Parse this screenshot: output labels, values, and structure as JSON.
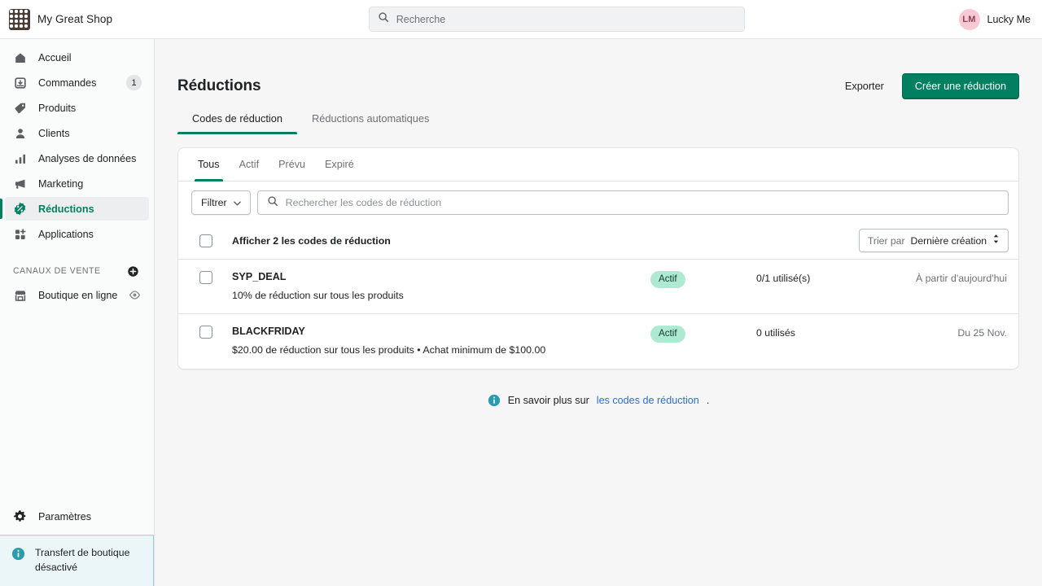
{
  "topbar": {
    "brand_name": "My Great Shop",
    "brand_logo_icon": "checkered-pattern-logo",
    "search": {
      "placeholder": "Recherche",
      "icon": "search-icon"
    },
    "user": {
      "initials": "LM",
      "name": "Lucky Me"
    }
  },
  "sidebar": {
    "items": [
      {
        "label": "Accueil",
        "icon": "home-icon",
        "badge": ""
      },
      {
        "label": "Commandes",
        "icon": "orders-inbox-icon",
        "badge": "1"
      },
      {
        "label": "Produits",
        "icon": "tag-icon",
        "badge": ""
      },
      {
        "label": "Clients",
        "icon": "person-icon",
        "badge": ""
      },
      {
        "label": "Analyses de données",
        "icon": "bar-chart-icon",
        "badge": ""
      },
      {
        "label": "Marketing",
        "icon": "megaphone-icon",
        "badge": ""
      },
      {
        "label": "Réductions",
        "icon": "discount-badge-icon",
        "badge": ""
      },
      {
        "label": "Applications",
        "icon": "apps-grid-icon",
        "badge": ""
      }
    ],
    "active_item": "Réductions",
    "sales_channels": {
      "title": "CANAUX DE VENTE",
      "add_icon": "plus-circle-icon",
      "channels": [
        {
          "label": "Boutique en ligne",
          "icon": "storefront-icon",
          "trailing_icon": "eye-icon"
        }
      ]
    },
    "settings": {
      "label": "Paramètres",
      "icon": "gear-icon"
    },
    "notice": {
      "text": "Transfert de boutique désactivé",
      "icon": "info-circle-icon"
    }
  },
  "page": {
    "title": "Réductions",
    "export_label": "Exporter",
    "create_label": "Créer une réduction",
    "top_tabs": [
      {
        "label": "Codes de réduction",
        "active": true
      },
      {
        "label": "Réductions automatiques",
        "active": false
      }
    ]
  },
  "card": {
    "tabs": [
      {
        "label": "Tous",
        "active": true
      },
      {
        "label": "Actif",
        "active": false
      },
      {
        "label": "Prévu",
        "active": false
      },
      {
        "label": "Expiré",
        "active": false
      }
    ],
    "filter_button": {
      "label": "Filtrer",
      "icon": "chevron-down-icon"
    },
    "search": {
      "placeholder": "Rechercher les codes de réduction",
      "value": "",
      "icon": "search-icon"
    },
    "select_all": {
      "label": "Afficher 2 les codes de réduction",
      "checked": false
    },
    "sort": {
      "prefix": "Trier par",
      "value": "Dernière création",
      "icon": "sort-updown-icon"
    },
    "rows": [
      {
        "code": "SYP_DEAL",
        "description": "10% de réduction sur tous les produits",
        "status": "Actif",
        "usage": "0/1 utilisé(s)",
        "date": "À partir d'aujourd'hui",
        "checked": false
      },
      {
        "code": "BLACKFRIDAY",
        "description": "$20.00 de réduction sur tous les produits • Achat minimum de $100.00",
        "status": "Actif",
        "usage": "0 utilisés",
        "date": "Du 25 Nov.",
        "checked": false
      }
    ]
  },
  "footer": {
    "icon": "info-circle-icon",
    "text": "En savoir plus sur ",
    "link_text": "les codes de réduction",
    "period": "."
  },
  "colors": {
    "accent_green": "#008060",
    "badge_green_bg": "#aee9d1",
    "link_blue": "#2c6ecb",
    "notice_teal": "#eaf6f8",
    "avatar_pink": "#f8c9d4"
  }
}
